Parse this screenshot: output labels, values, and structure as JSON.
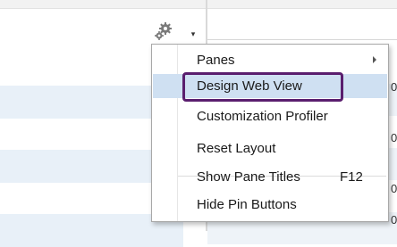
{
  "toolbar": {
    "gear_icon": "gear-icon",
    "dropdown_glyph": "▾"
  },
  "background_peek": {
    "right_fragments": [
      "0",
      "0",
      "0",
      "0"
    ]
  },
  "menu": {
    "items": [
      {
        "label": "Panes",
        "shortcut": "",
        "has_submenu": true
      },
      {
        "label": "Design Web View",
        "shortcut": "",
        "has_submenu": false,
        "highlighted": true
      },
      {
        "label": "Customization Profiler",
        "shortcut": "",
        "has_submenu": false
      },
      {
        "label": "Reset Layout",
        "shortcut": "",
        "has_submenu": false
      },
      {
        "label": "Show Pane Titles",
        "shortcut": "F12",
        "has_submenu": false
      },
      {
        "label": "Hide Pin Buttons",
        "shortcut": "",
        "has_submenu": false
      }
    ]
  },
  "colors": {
    "highlight_background": "#cfe0f2",
    "highlight_frame": "#5a1e6e",
    "menu_border": "#a8a8a8"
  }
}
